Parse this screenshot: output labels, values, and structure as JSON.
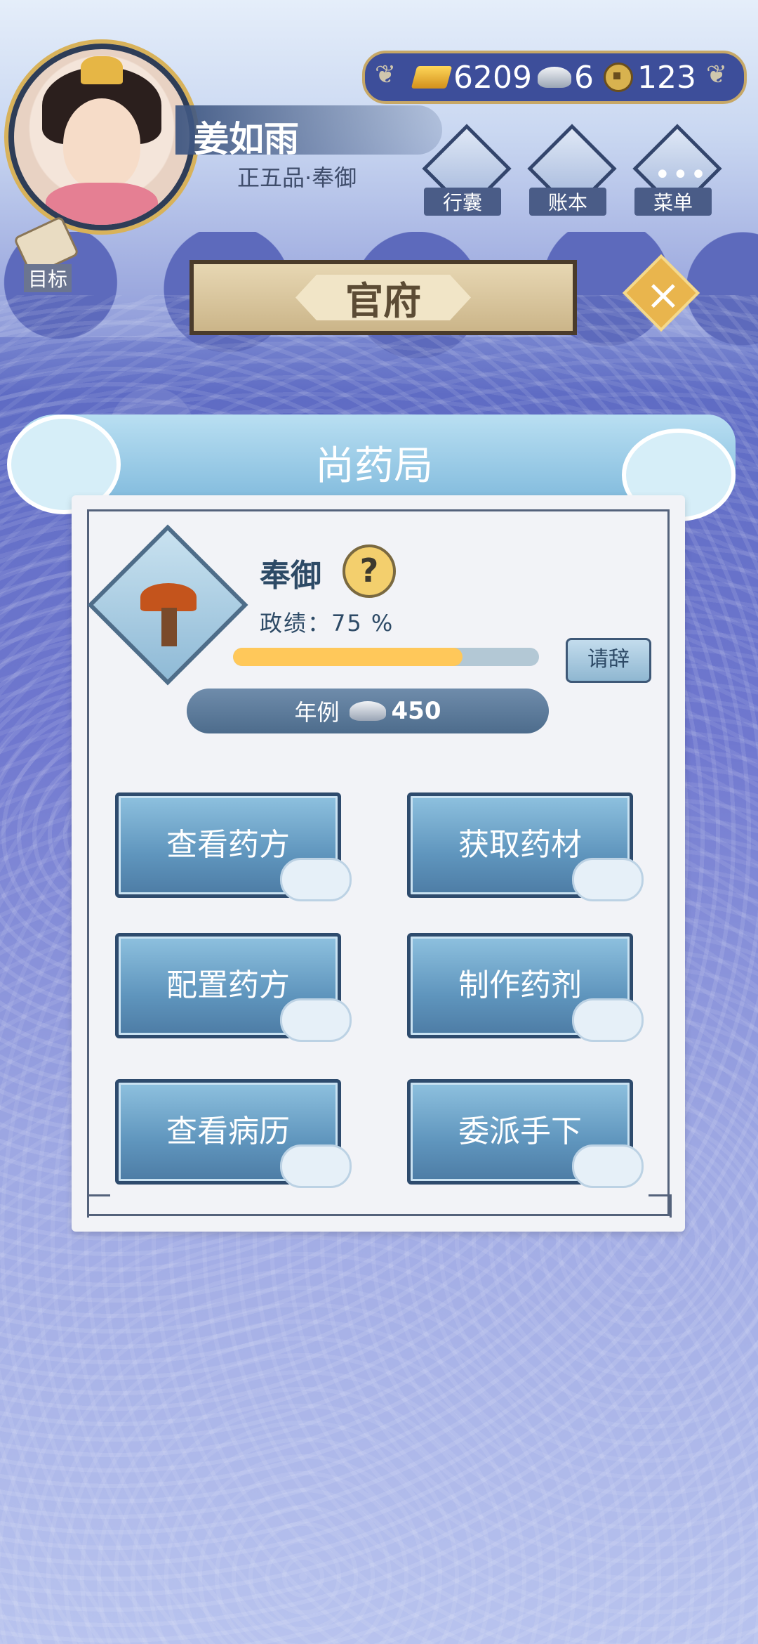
{
  "player": {
    "name": "姜如雨",
    "rank": "正五品·奉御"
  },
  "target": {
    "label": "目标"
  },
  "currency": {
    "gold": "6209",
    "silver": "6",
    "coins": "123"
  },
  "menu_buttons": [
    {
      "label": "行囊",
      "icon": "bundle-icon"
    },
    {
      "label": "账本",
      "icon": "ledger-icon"
    },
    {
      "label": "菜单",
      "icon": "menu-dots-icon"
    }
  ],
  "banner": {
    "title": "官府"
  },
  "panel": {
    "title": "尚药局",
    "post_name": "奉御",
    "performance_label": "政绩：75 %",
    "performance_value": 75,
    "resign_label": "请辞",
    "salary_label": "年例",
    "salary_value": "450",
    "actions": [
      {
        "label": "查看药方"
      },
      {
        "label": "获取药材"
      },
      {
        "label": "配置药方"
      },
      {
        "label": "制作药剂"
      },
      {
        "label": "查看病历"
      },
      {
        "label": "委派手下"
      }
    ]
  },
  "colors": {
    "progress_fill": "#ffc85a",
    "button_blue": "#5f95bd",
    "gold_accent": "#e9b54d"
  }
}
